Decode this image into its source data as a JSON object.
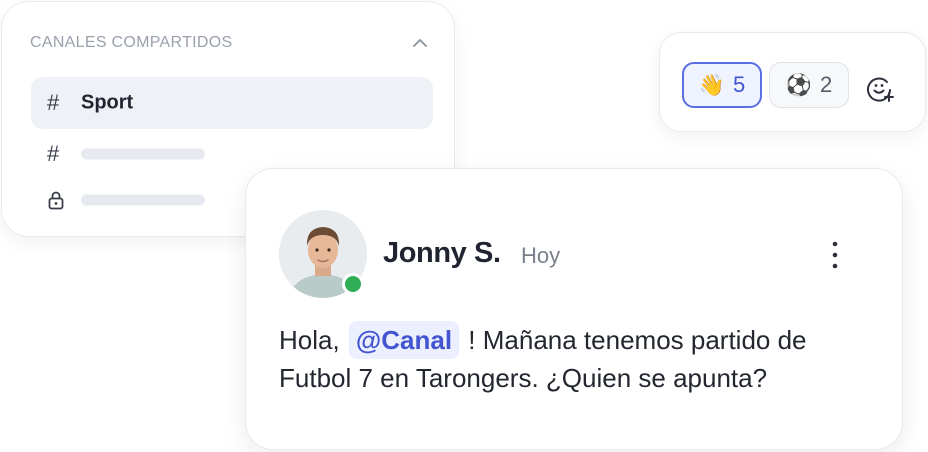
{
  "channels": {
    "title": "CANALES COMPARTIDOS",
    "items": [
      {
        "type": "hash",
        "symbol": "#",
        "label": "Sport",
        "active": true
      },
      {
        "type": "hash",
        "symbol": "#",
        "label": "",
        "active": false
      },
      {
        "type": "lock",
        "label": "",
        "active": false
      }
    ]
  },
  "reactions": {
    "items": [
      {
        "emoji": "👋",
        "count": "5",
        "selected": true
      },
      {
        "emoji": "⚽",
        "count": "2",
        "selected": false
      }
    ],
    "add_icon": "add-emoji-icon"
  },
  "message": {
    "author": "Jonny S.",
    "time": "Hoy",
    "online": true,
    "text_before": "Hola, ",
    "mention": "@Canal",
    "text_after": " ! Mañana tenemos partido de Futbol 7 en Tarongers. ¿Quien se apunta?"
  },
  "colors": {
    "accent": "#5b6ee1",
    "online": "#2fae55",
    "muted_text": "#9aa1ad"
  }
}
